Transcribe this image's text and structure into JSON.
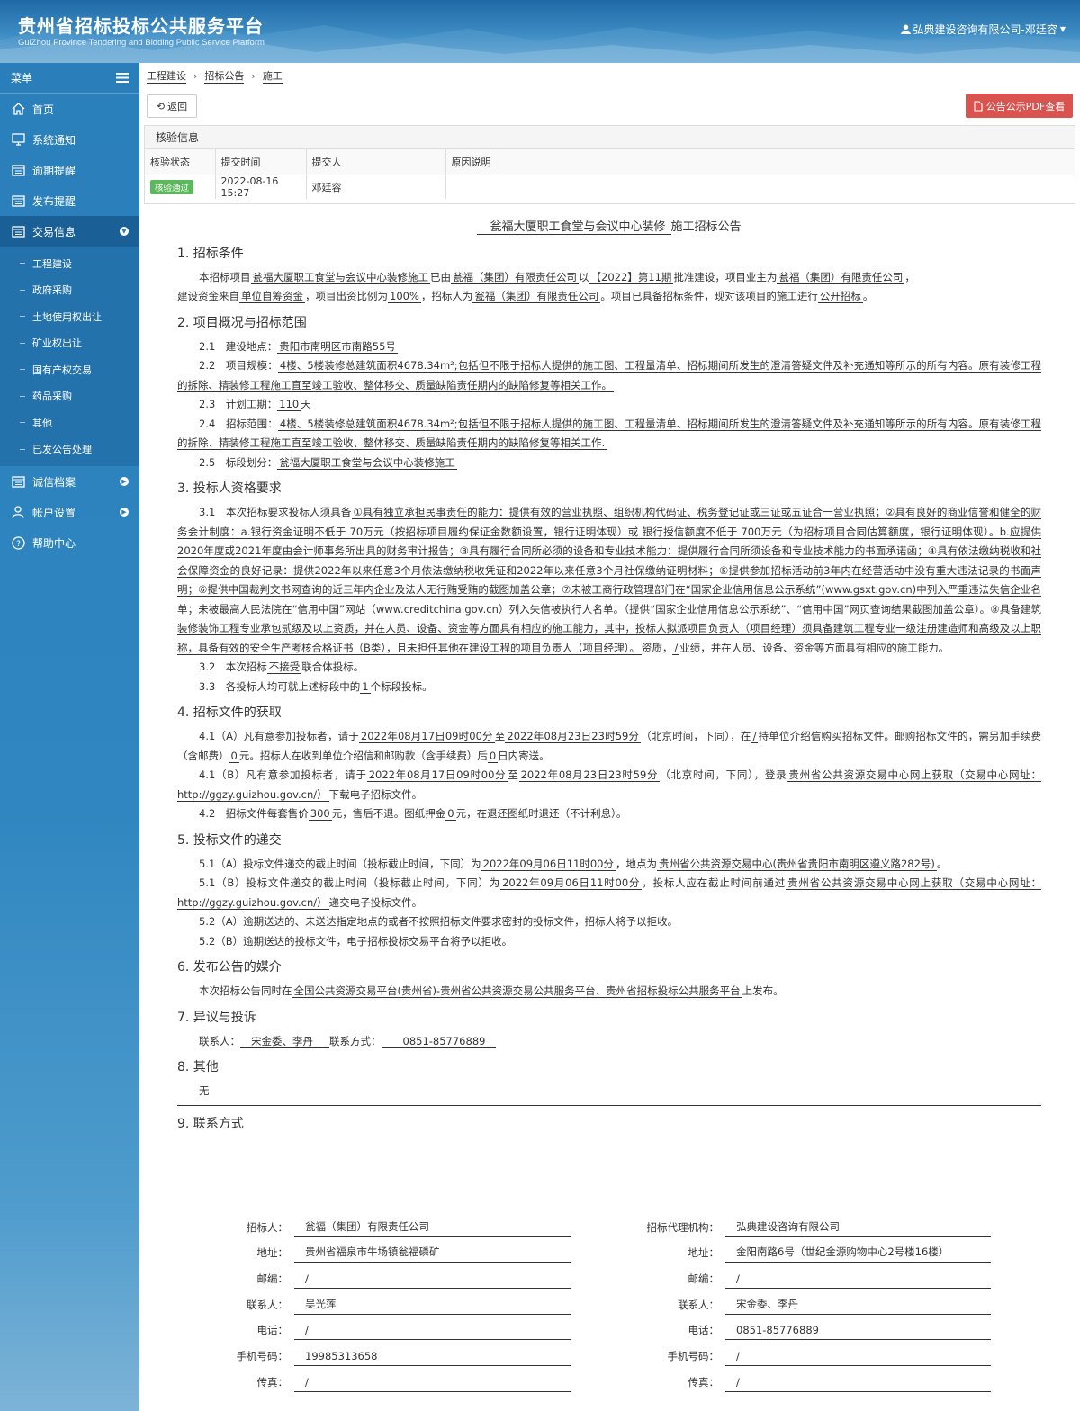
{
  "header": {
    "title_cn": "贵州省招标投标公共服务平台",
    "title_en": "GuiZhou Province Tendering and Bidding Public Service Platform",
    "user": "弘典建设咨询有限公司-邓廷容"
  },
  "sidebar": {
    "menu_label": "菜单",
    "items": [
      {
        "label": "首页",
        "icon": "home-icon"
      },
      {
        "label": "系统通知",
        "icon": "monitor-icon"
      },
      {
        "label": "逾期提醒",
        "icon": "list-icon"
      },
      {
        "label": "发布提醒",
        "icon": "list-icon"
      },
      {
        "label": "交易信息",
        "icon": "list-icon"
      }
    ],
    "sub_items": [
      "工程建设",
      "政府采购",
      "土地使用权出让",
      "矿业权出让",
      "国有产权交易",
      "药品采购",
      "其他",
      "已发公告处理"
    ],
    "bottom_items": [
      {
        "label": "诚信档案",
        "icon": "list-icon"
      },
      {
        "label": "帐户设置",
        "icon": "user-icon"
      },
      {
        "label": "帮助中心",
        "icon": "help-icon"
      }
    ]
  },
  "breadcrumb": [
    "工程建设",
    "招标公告",
    "施工"
  ],
  "toolbar": {
    "back": "返回",
    "pdf": "公告公示PDF查看"
  },
  "verify": {
    "title": "核验信息",
    "headers": [
      "核验状态",
      "提交时间",
      "提交人",
      "原因说明"
    ],
    "status": "核验通过",
    "time": "2022-08-16 15:27",
    "submitter": "邓廷容",
    "reason": ""
  },
  "doc": {
    "title_project": "瓮福大厦职工食堂与会议中心装修",
    "title_suffix": "施工招标公告",
    "s1": {
      "h": "1. 招标条件",
      "a": "本招标项目",
      "b": "瓮福大厦职工食堂与会议中心装修施工",
      "c": "已由",
      "d": "瓮福（集团）有限责任公司",
      "e": "以",
      "f": "【2022】第11期",
      "g": "批准建设，项目业主为",
      "h2": "瓮福（集团）有限责任公司",
      "i": "，",
      "j": "建设资金来自",
      "k": "单位自筹资金",
      "l": "，项目出资比例为",
      "m": "100%",
      "n": "，招标人为",
      "o": "瓮福（集团）有限责任公司",
      "p": "。项目已具备招标条件，现对该项目的施工进行",
      "q": "公开招标",
      "r": "。"
    },
    "s2": {
      "h": "2. 项目概况与招标范围",
      "l1a": "2.1　建设地点：",
      "l1b": "贵阳市南明区市南路55号",
      "l2a": "2.2　项目规模：",
      "l2b": "4楼、5楼装修总建筑面积4678.34m²;包括但不限于招标人提供的施工图、工程量清单、招标期间所发生的澄清答疑文件及补充通知等所示的所有内容。原有装修工程的拆除、精装修工程施工直至竣工验收、整体移交、质量缺陷责任期内的缺陷修复等相关工作。",
      "l3a": "2.3　计划工期：",
      "l3b": "110",
      "l3c": "天",
      "l4a": "2.4　招标范围：",
      "l4b": "4楼、5楼装修总建筑面积4678.34m²;包括但不限于招标人提供的施工图、工程量清单、招标期间所发生的澄清答疑文件及补充通知等所示的所有内容。原有装修工程的拆除、精装修工程施工直至竣工验收、整体移交、质量缺陷责任期内的缺陷修复等相关工作.",
      "l5a": "2.5　标段划分：",
      "l5b": "瓮福大厦职工食堂与会议中心装修施工"
    },
    "s3": {
      "h": "3. 投标人资格要求",
      "l1a": "3.1　本次招标要求投标人须具备",
      "l1b": "①具有独立承担民事责任的能力：提供有效的营业执照、组织机构代码证、税务登记证或三证或五证合一营业执照；②具有良好的商业信誉和健全的财务会计制度：a.银行资金证明不低于 70万元（按招标项目履约保证金数额设置，银行证明体现）或 银行授信额度不低于 700万元（为招标项目合同估算额度，银行证明体现）。b.应提供2020年度或2021年度由会计师事务所出具的财务审计报告；③具有履行合同所必须的设备和专业技术能力：提供履行合同所须设备和专业技术能力的书面承诺函；④具有依法缴纳税收和社会保障资金的良好记录：提供2022年以来任意3个月依法缴纳税收凭证和2022年以来任意3个月社保缴纳证明材料；⑤提供参加招标活动前3年内在经营活动中没有重大违法记录的书面声明；⑥提供中国裁判文书网查询的近三年内企业及法人无行贿受贿的截图加盖公章；⑦未被工商行政管理部门在“国家企业信用信息公示系统”(www.gsxt.gov.cn)中列入严重违法失信企业名单；未被最高人民法院在“信用中国”网站（www.creditchina.gov.cn）列入失信被执行人名单。（提供“国家企业信用信息公示系统”、“信用中国”网页查询结果截图加盖公章）。⑧具备建筑装修装饰工程专业承包贰级及以上资质，并在人员、设备、资金等方面具有相应的施工能力，其中，投标人拟派项目负责人（项目经理）须具备建筑工程专业一级注册建造师和高级及以上职称，具备有效的安全生产考核合格证书（B类），且未担任其他在建设工程的项目负责人（项目经理）。",
      "l1c": "资质，",
      "l1d": "/",
      "l1e": "业绩，并在人员、设备、资金等方面具有相应的施工能力。",
      "l2a": "3.2　本次招标",
      "l2b": "不接受",
      "l2c": "联合体投标。",
      "l3a": "3.3　各投标人均可就上述标段中的",
      "l3b": "1",
      "l3c": "个标段投标。"
    },
    "s4": {
      "h": "4. 招标文件的获取",
      "l1a": "4.1（A）凡有意参加投标者，请于",
      "l1b": "2022年08月17日09时00分",
      "l1c": "至",
      "l1d": "2022年08月23日23时59分",
      "l1e": "（北京时间，下同），在",
      "l1f": "/",
      "l1g": "持单位介绍信购买招标文件。邮购招标文件的，需另加手续费（含邮费）",
      "l1h": "0",
      "l1i": "元。招标人在收到单位介绍信和邮购款（含手续费）后",
      "l1j": "0",
      "l1k": "日内寄送。",
      "l2a": "4.1（B）凡有意参加投标者，请于",
      "l2b": "2022年08月17日09时00分",
      "l2c": "至",
      "l2d": "2022年08月23日23时59分",
      "l2e": "（北京时间，下同），登录",
      "l2f": "贵州省公共资源交易中心网上获取（交易中心网址：http://ggzy.guizhou.gov.cn/）",
      "l2g": "下载电子招标文件。",
      "l3a": "4.2　招标文件每套售价",
      "l3b": "300",
      "l3c": "元，售后不退。图纸押金",
      "l3d": "0",
      "l3e": "元，在退还图纸时退还（不计利息）。"
    },
    "s5": {
      "h": "5. 投标文件的递交",
      "l1a": "5.1（A）投标文件递交的截止时间（投标截止时间，下同）为",
      "l1b": "2022年09月06日11时00分",
      "l1c": "，地点为",
      "l1d": "贵州省公共资源交易中心(贵州省贵阳市南明区遵义路282号)",
      "l1e": "。",
      "l2a": "5.1（B）投标文件递交的截止时间（投标截止时间，下同）为",
      "l2b": "2022年09月06日11时00分",
      "l2c": "，投标人应在截止时间前通过",
      "l2d": "贵州省公共资源交易中心网上获取（交易中心网址：http://ggzy.guizhou.gov.cn/）",
      "l2e": "递交电子投标文件。",
      "l3": "5.2（A）逾期送达的、未送达指定地点的或者不按照招标文件要求密封的投标文件，招标人将予以拒收。",
      "l4": "5.2（B）逾期送达的投标文件，电子招标投标交易平台将予以拒收。"
    },
    "s6": {
      "h": "6. 发布公告的媒介",
      "a": "本次招标公告同时在",
      "b": "全国公共资源交易平台(贵州省)-贵州省公共资源交易公共服务平台、贵州省招标投标公共服务平台",
      "c": "上发布。"
    },
    "s7": {
      "h": "7. 异议与投诉",
      "a": "联系人：",
      "b": "宋金委、李丹",
      "c": "联系方式：",
      "d": "0851-85776889"
    },
    "s8": {
      "h": "8. 其他",
      "a": "无"
    },
    "s9": {
      "h": "9. 联系方式"
    }
  },
  "contact": {
    "left": [
      {
        "label": "招标人：",
        "value": "瓮福（集团）有限责任公司"
      },
      {
        "label": "地址：",
        "value": "贵州省福泉市牛场镇瓮福磷矿"
      },
      {
        "label": "邮编：",
        "value": "/"
      },
      {
        "label": "联系人：",
        "value": "吴光莲"
      },
      {
        "label": "电话：",
        "value": "/"
      },
      {
        "label": "手机号码：",
        "value": "19985313658"
      },
      {
        "label": "传真：",
        "value": "/"
      }
    ],
    "right": [
      {
        "label": "招标代理机构：",
        "value": "弘典建设咨询有限公司"
      },
      {
        "label": "地址：",
        "value": "金阳南路6号（世纪金源购物中心2号楼16楼）"
      },
      {
        "label": "邮编：",
        "value": "/"
      },
      {
        "label": "联系人：",
        "value": "宋金委、李丹"
      },
      {
        "label": "电话：",
        "value": "0851-85776889"
      },
      {
        "label": "手机号码：",
        "value": "/"
      },
      {
        "label": "传真：",
        "value": "/"
      }
    ]
  }
}
